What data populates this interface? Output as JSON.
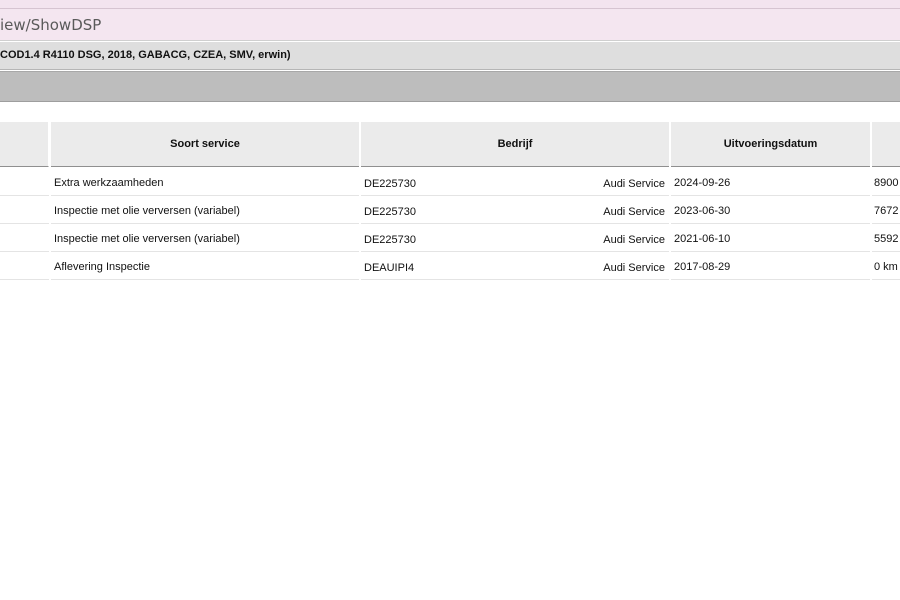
{
  "url_bar": {
    "path_text": "iew/ShowDSP"
  },
  "vehicle_bar": {
    "text": "COD1.4 R4110 DSG, 2018, GABACG, CZEA, SMV, erwin)"
  },
  "table": {
    "headers": {
      "soort_service": "Soort service",
      "bedrijf": "Bedrijf",
      "uitvoeringsdatum": "Uitvoeringsdatum"
    },
    "rows": [
      {
        "soort_service": "Extra werkzaamheden",
        "bedrijf_code": "DE225730",
        "bedrijf_naam": "Audi Service",
        "uitvoeringsdatum": "2024-09-26",
        "km": "8900"
      },
      {
        "soort_service": "Inspectie met olie verversen (variabel)",
        "bedrijf_code": "DE225730",
        "bedrijf_naam": "Audi Service",
        "uitvoeringsdatum": "2023-06-30",
        "km": "7672"
      },
      {
        "soort_service": "Inspectie met olie verversen (variabel)",
        "bedrijf_code": "DE225730",
        "bedrijf_naam": "Audi Service",
        "uitvoeringsdatum": "2021-06-10",
        "km": "5592"
      },
      {
        "soort_service": "Aflevering Inspectie",
        "bedrijf_code": "DEAUIPI4",
        "bedrijf_naam": "Audi Service",
        "uitvoeringsdatum": "2017-08-29",
        "km": "0 km"
      }
    ]
  }
}
